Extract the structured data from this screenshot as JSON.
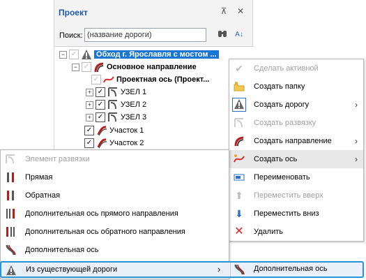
{
  "panel": {
    "title": "Проект",
    "pin_icon": "pin-icon",
    "close_icon": "close-icon",
    "search_label": "Поиск:",
    "search_placeholder": "(название дороги)",
    "binoculars_icon": "binoculars-icon",
    "sort_icon": "sort-az-icon"
  },
  "tree": {
    "root": "Обход г. Ярославля с мостом ...",
    "direction": "Основное направление",
    "axis": "Проектная ось (Проект...",
    "nodes": [
      "УЗЕЛ 1",
      "УЗЕЛ 2",
      "УЗЕЛ 3"
    ],
    "sections": [
      "Участок 1",
      "Участок 2"
    ]
  },
  "menu1": {
    "items": [
      {
        "label": "Сделать активной",
        "icon": "check-icon",
        "disabled": true
      },
      {
        "label": "Создать папку",
        "icon": "folder-new-icon",
        "disabled": false
      },
      {
        "label": "Создать дорогу",
        "icon": "road-icon",
        "disabled": false,
        "submenu": true
      },
      {
        "label": "Создать развязку",
        "icon": "interchange-icon",
        "disabled": true
      },
      {
        "label": "Создать направление",
        "icon": "direction-icon",
        "disabled": false,
        "submenu": true
      },
      {
        "label": "Создать ось",
        "icon": "axis-icon",
        "disabled": false,
        "submenu": true,
        "highlighted": true
      },
      {
        "label": "Переименовать",
        "icon": "rename-icon",
        "disabled": false
      },
      {
        "label": "Переместить вверх",
        "icon": "arrow-up-icon",
        "disabled": true
      },
      {
        "label": "Переместить вниз",
        "icon": "arrow-down-icon",
        "disabled": false
      },
      {
        "label": "Удалить",
        "icon": "delete-icon",
        "disabled": false
      }
    ]
  },
  "menu2": {
    "items": [
      {
        "label": "Элемент развязки",
        "icon": "interchange-element-icon",
        "disabled": true
      },
      {
        "label": "Прямая",
        "icon": "forward-road-icon",
        "disabled": false
      },
      {
        "label": "Обратная",
        "icon": "reverse-road-icon",
        "disabled": false
      },
      {
        "label": "Дополнительная ось прямого направления",
        "icon": "forward-extra-axis-icon",
        "disabled": false
      },
      {
        "label": "Дополнительная ось обратного направления",
        "icon": "reverse-extra-axis-icon",
        "disabled": false
      },
      {
        "label": "Дополнительная ось",
        "icon": "extra-axis-icon",
        "disabled": false
      },
      {
        "label": "Из существующей дороги",
        "icon": "road-icon",
        "disabled": false,
        "submenu": true,
        "highlighted": true
      }
    ]
  },
  "submenu3": {
    "label": "Дополнительная ось",
    "icon": "extra-axis-icon"
  },
  "colors": {
    "selection": "#1976d2",
    "title": "#1e5aa8",
    "highlight_border": "#2a93d5",
    "delete": "#e02020"
  }
}
